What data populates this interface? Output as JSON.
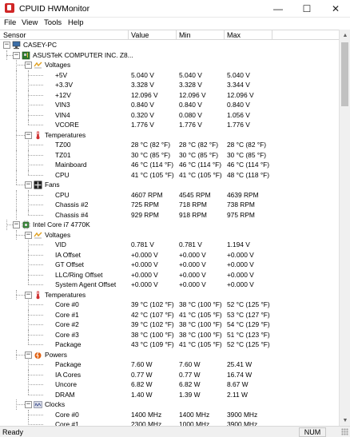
{
  "window": {
    "title": "CPUID HWMonitor",
    "minimize": "—",
    "maximize": "☐",
    "close": "✕"
  },
  "menu": [
    "File",
    "View",
    "Tools",
    "Help"
  ],
  "columns": [
    "Sensor",
    "Value",
    "Min",
    "Max"
  ],
  "colors": {
    "temperature_icon": "#d03030",
    "voltage_icon": "#e0a020",
    "power_icon": "#e06010",
    "chip_icon": "#3a8a3a"
  },
  "rows": [
    {
      "level": 0,
      "type": "node",
      "icon": "computer-icon",
      "label": "CASEY-PC"
    },
    {
      "level": 1,
      "type": "node",
      "icon": "motherboard-icon",
      "label": "ASUSTeK COMPUTER INC. Z8..."
    },
    {
      "level": 2,
      "type": "group",
      "icon": "voltage-icon",
      "label": "Voltages"
    },
    {
      "level": 3,
      "type": "leaf",
      "label": "+5V",
      "value": "5.040 V",
      "min": "5.040 V",
      "max": "5.040 V"
    },
    {
      "level": 3,
      "type": "leaf",
      "label": "+3.3V",
      "value": "3.328 V",
      "min": "3.328 V",
      "max": "3.344 V"
    },
    {
      "level": 3,
      "type": "leaf",
      "label": "+12V",
      "value": "12.096 V",
      "min": "12.096 V",
      "max": "12.096 V"
    },
    {
      "level": 3,
      "type": "leaf",
      "label": "VIN3",
      "value": "0.840 V",
      "min": "0.840 V",
      "max": "0.840 V"
    },
    {
      "level": 3,
      "type": "leaf",
      "label": "VIN4",
      "value": "0.320 V",
      "min": "0.080 V",
      "max": "1.056 V"
    },
    {
      "level": 3,
      "type": "leaf",
      "label": "VCORE",
      "value": "1.776 V",
      "min": "1.776 V",
      "max": "1.776 V"
    },
    {
      "level": 2,
      "type": "group",
      "icon": "temperature-icon",
      "label": "Temperatures"
    },
    {
      "level": 3,
      "type": "leaf",
      "label": "TZ00",
      "value": "28 °C  (82 °F)",
      "min": "28 °C  (82 °F)",
      "max": "28 °C  (82 °F)"
    },
    {
      "level": 3,
      "type": "leaf",
      "label": "TZ01",
      "value": "30 °C  (85 °F)",
      "min": "30 °C  (85 °F)",
      "max": "30 °C  (85 °F)"
    },
    {
      "level": 3,
      "type": "leaf",
      "label": "Mainboard",
      "value": "46 °C  (114 °F)",
      "min": "46 °C  (114 °F)",
      "max": "46 °C  (114 °F)"
    },
    {
      "level": 3,
      "type": "leaf",
      "label": "CPU",
      "value": "41 °C  (105 °F)",
      "min": "41 °C  (105 °F)",
      "max": "48 °C  (118 °F)"
    },
    {
      "level": 2,
      "type": "group",
      "icon": "fan-icon",
      "label": "Fans"
    },
    {
      "level": 3,
      "type": "leaf",
      "label": "CPU",
      "value": "4607 RPM",
      "min": "4545 RPM",
      "max": "4639 RPM"
    },
    {
      "level": 3,
      "type": "leaf",
      "label": "Chassis #2",
      "value": "725 RPM",
      "min": "718 RPM",
      "max": "738 RPM"
    },
    {
      "level": 3,
      "type": "leaf",
      "label": "Chassis #4",
      "value": "929 RPM",
      "min": "918 RPM",
      "max": "975 RPM"
    },
    {
      "level": 1,
      "type": "node",
      "icon": "cpu-chip-icon",
      "label": "Intel Core i7 4770K"
    },
    {
      "level": 2,
      "type": "group",
      "icon": "voltage-icon",
      "label": "Voltages"
    },
    {
      "level": 3,
      "type": "leaf",
      "label": "VID",
      "value": "0.781 V",
      "min": "0.781 V",
      "max": "1.194 V"
    },
    {
      "level": 3,
      "type": "leaf",
      "label": "IA Offset",
      "value": "+0.000 V",
      "min": "+0.000 V",
      "max": "+0.000 V"
    },
    {
      "level": 3,
      "type": "leaf",
      "label": "GT Offset",
      "value": "+0.000 V",
      "min": "+0.000 V",
      "max": "+0.000 V"
    },
    {
      "level": 3,
      "type": "leaf",
      "label": "LLC/Ring Offset",
      "value": "+0.000 V",
      "min": "+0.000 V",
      "max": "+0.000 V"
    },
    {
      "level": 3,
      "type": "leaf",
      "label": "System Agent Offset",
      "value": "+0.000 V",
      "min": "+0.000 V",
      "max": "+0.000 V"
    },
    {
      "level": 2,
      "type": "group",
      "icon": "temperature-icon",
      "label": "Temperatures"
    },
    {
      "level": 3,
      "type": "leaf",
      "label": "Core #0",
      "value": "39 °C  (102 °F)",
      "min": "38 °C  (100 °F)",
      "max": "52 °C  (125 °F)"
    },
    {
      "level": 3,
      "type": "leaf",
      "label": "Core #1",
      "value": "42 °C  (107 °F)",
      "min": "41 °C  (105 °F)",
      "max": "53 °C  (127 °F)"
    },
    {
      "level": 3,
      "type": "leaf",
      "label": "Core #2",
      "value": "39 °C  (102 °F)",
      "min": "38 °C  (100 °F)",
      "max": "54 °C  (129 °F)"
    },
    {
      "level": 3,
      "type": "leaf",
      "label": "Core #3",
      "value": "38 °C  (100 °F)",
      "min": "38 °C  (100 °F)",
      "max": "51 °C  (123 °F)"
    },
    {
      "level": 3,
      "type": "leaf",
      "label": "Package",
      "value": "43 °C  (109 °F)",
      "min": "41 °C  (105 °F)",
      "max": "52 °C  (125 °F)"
    },
    {
      "level": 2,
      "type": "group",
      "icon": "power-icon",
      "label": "Powers"
    },
    {
      "level": 3,
      "type": "leaf",
      "label": "Package",
      "value": "7.60 W",
      "min": "7.60 W",
      "max": "25.41 W"
    },
    {
      "level": 3,
      "type": "leaf",
      "label": "IA Cores",
      "value": "0.77 W",
      "min": "0.77 W",
      "max": "16.74 W"
    },
    {
      "level": 3,
      "type": "leaf",
      "label": "Uncore",
      "value": "6.82 W",
      "min": "6.82 W",
      "max": "8.67 W"
    },
    {
      "level": 3,
      "type": "leaf",
      "label": "DRAM",
      "value": "1.40 W",
      "min": "1.39 W",
      "max": "2.11 W"
    },
    {
      "level": 2,
      "type": "group",
      "icon": "clock-icon",
      "label": "Clocks"
    },
    {
      "level": 3,
      "type": "leaf",
      "label": "Core #0",
      "value": "1400 MHz",
      "min": "1400 MHz",
      "max": "3900 MHz"
    },
    {
      "level": 3,
      "type": "leaf",
      "label": "Core #1",
      "value": "2300 MHz",
      "min": "1000 MHz",
      "max": "3900 MHz"
    }
  ],
  "status": {
    "text": "Ready",
    "num": "NUM"
  }
}
